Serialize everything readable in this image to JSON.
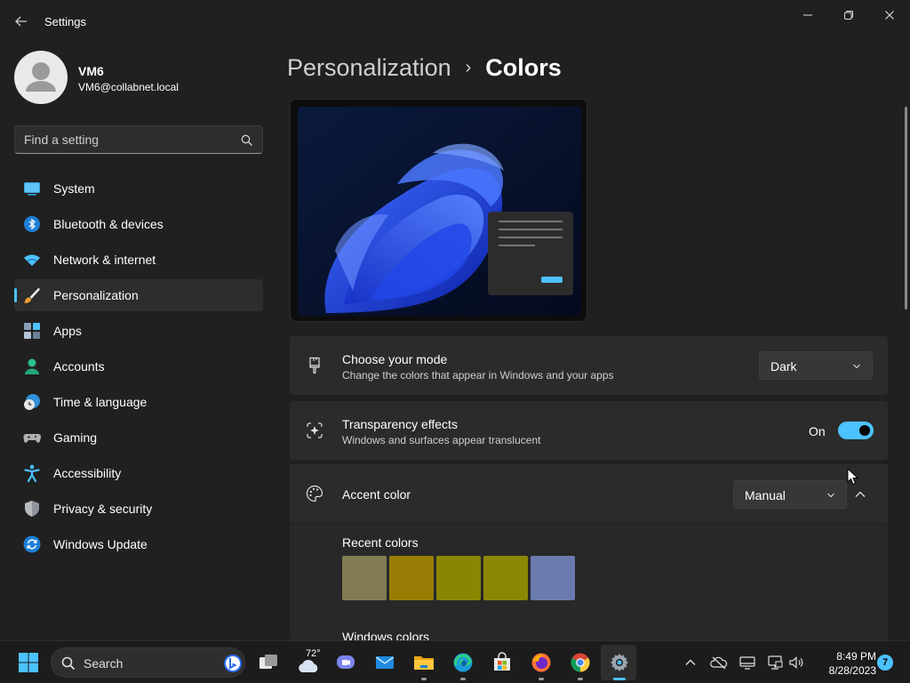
{
  "window": {
    "title": "Settings"
  },
  "profile": {
    "name": "VM6",
    "email": "VM6@collabnet.local"
  },
  "search": {
    "placeholder": "Find a setting"
  },
  "nav": {
    "items": [
      {
        "label": "System",
        "icon": "system-icon"
      },
      {
        "label": "Bluetooth & devices",
        "icon": "bluetooth-icon"
      },
      {
        "label": "Network & internet",
        "icon": "wifi-icon"
      },
      {
        "label": "Personalization",
        "icon": "brush-icon",
        "active": true
      },
      {
        "label": "Apps",
        "icon": "apps-icon"
      },
      {
        "label": "Accounts",
        "icon": "accounts-icon"
      },
      {
        "label": "Time & language",
        "icon": "clock-globe-icon"
      },
      {
        "label": "Gaming",
        "icon": "gamepad-icon"
      },
      {
        "label": "Accessibility",
        "icon": "accessibility-icon"
      },
      {
        "label": "Privacy & security",
        "icon": "shield-icon"
      },
      {
        "label": "Windows Update",
        "icon": "update-icon"
      }
    ]
  },
  "header": {
    "parent": "Personalization",
    "separator": "›",
    "current": "Colors"
  },
  "mode": {
    "title": "Choose your mode",
    "description": "Change the colors that appear in Windows and your apps",
    "value": "Dark"
  },
  "transparency": {
    "title": "Transparency effects",
    "description": "Windows and surfaces appear translucent",
    "state_label": "On",
    "enabled": true
  },
  "accent": {
    "title": "Accent color",
    "value": "Manual",
    "expanded": true,
    "recent_label": "Recent colors",
    "recent_colors": [
      "#837c52",
      "#987d05",
      "#8a8602",
      "#8b8704",
      "#6b7bb0"
    ],
    "windows_label": "Windows colors"
  },
  "taskbar": {
    "search_label": "Search",
    "weather_temp": "72°",
    "time": "8:49 PM",
    "date": "8/28/2023",
    "notification_count": "7"
  },
  "colors": {
    "accent": "#4cc2ff",
    "background": "#202020",
    "card": "#2b2b2b"
  }
}
